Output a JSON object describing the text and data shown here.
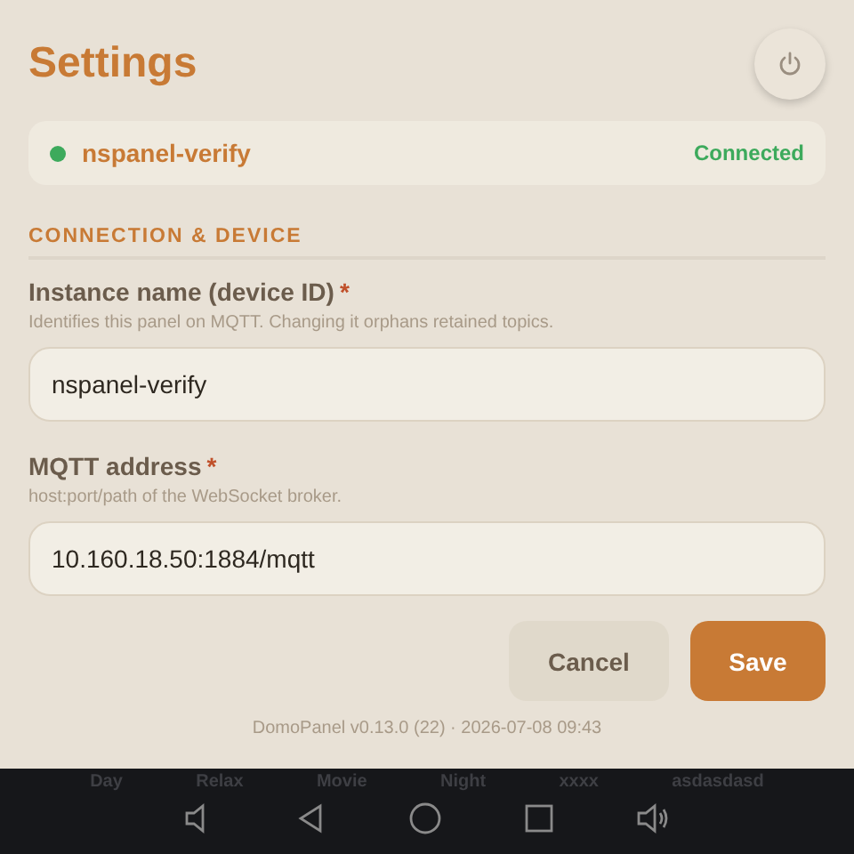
{
  "title": "Settings",
  "status": {
    "name": "nspanel-verify",
    "state": "Connected",
    "connected": true
  },
  "section": "CONNECTION & DEVICE",
  "fields": [
    {
      "label": "Instance name (device ID)",
      "required": true,
      "hint": "Identifies this panel on MQTT. Changing it orphans retained topics.",
      "value": "nspanel-verify"
    },
    {
      "label": "MQTT address",
      "required": true,
      "hint": "host:port/path of the WebSocket broker.",
      "value": "10.160.18.50:1884/mqtt"
    }
  ],
  "required_mark": "*",
  "buttons": [
    {
      "label": "Cancel",
      "kind": "secondary"
    },
    {
      "label": "Save",
      "kind": "primary"
    }
  ],
  "version": "DomoPanel v0.13.0 (22) · 2026-07-08 09:43",
  "scenes": [
    "Day",
    "Relax",
    "Movie",
    "Night",
    "xxxx",
    "asdasdasd"
  ]
}
